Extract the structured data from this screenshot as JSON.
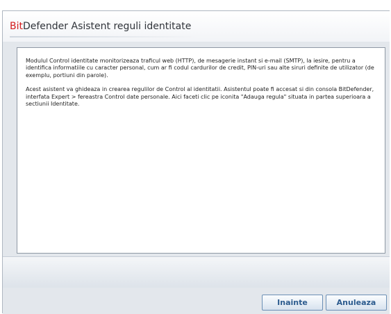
{
  "window": {
    "title_brand": "Bit",
    "title_rest": "Defender Asistent reguli identitate"
  },
  "content": {
    "paragraph1": "Modulul Control identitate monitorizeaza traficul web (HTTP), de mesagerie instant si e-mail (SMTP), la iesire, pentru a identifica informatiile cu caracter personal, cum ar fi codul cardurilor de credit, PIN-uri sau alte siruri definite de utilizator (de exemplu, portiuni din parole).",
    "paragraph2": "Acest asistent va ghideaza in crearea regulilor de Control al identitatii. Asistentul poate fi accesat si din consola BitDefender, interfata Expert > fereastra Control date personale. Aici faceti clic pe iconita \"Adauga regula\" situata in partea superioara a sectiunii Identitate."
  },
  "buttons": {
    "next_label": "Inainte",
    "cancel_label": "Anuleaza"
  },
  "colors": {
    "brand_red": "#d41c1c",
    "button_text": "#2c5b8e"
  }
}
